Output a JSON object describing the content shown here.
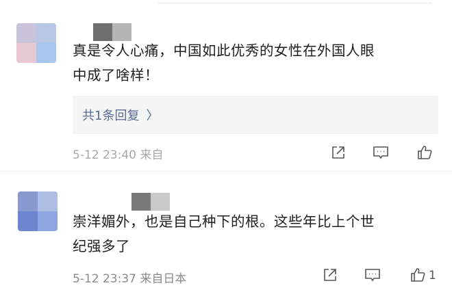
{
  "comments": [
    {
      "text_line1": "真是令人心痛，中国如此优秀的女性在外国人眼",
      "text_line2": "中成了啥样！",
      "replies_label": "共1条回复",
      "replies_chevron": "〉",
      "meta": "5-12 23:40 来自",
      "avatar_colors": [
        "#c9c3dc",
        "#b7c7e6",
        "#e6c8d3",
        "#a9c6ee"
      ],
      "nickname_colors": [
        "#6f6f6f",
        "#b5b5b5"
      ]
    },
    {
      "text_line1": "崇洋媚外，也是自己种下的根。这些年比上个世",
      "text_line2": "纪强多了",
      "meta": "5-12 23:37 来自日本",
      "like_count": "1",
      "avatar_colors": [
        "#8a9ad0",
        "#aebee3",
        "#6d86cf",
        "#8ea6e0"
      ],
      "nickname_colors": [
        "#7a7a7a",
        "#c9c9c9"
      ]
    }
  ],
  "icons": {
    "share": "share-icon",
    "reply": "comment-icon",
    "like": "thumbs-up-icon"
  }
}
